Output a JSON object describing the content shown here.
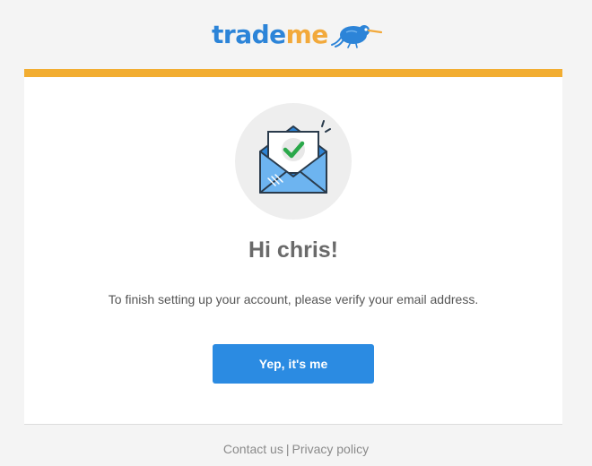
{
  "brand": {
    "part1": "trade",
    "part2": "me",
    "colors": {
      "blue": "#2c84d8",
      "orange": "#f2a93b"
    }
  },
  "card": {
    "accent_color": "#f2ad31",
    "icon": "email-verified-icon",
    "greeting": "Hi chris!",
    "message": "To finish setting up your account, please verify your email address.",
    "button_label": "Yep, it's me",
    "button_color": "#2b8be2"
  },
  "footer": {
    "contact_label": "Contact us",
    "separator": "|",
    "privacy_label": "Privacy policy"
  }
}
